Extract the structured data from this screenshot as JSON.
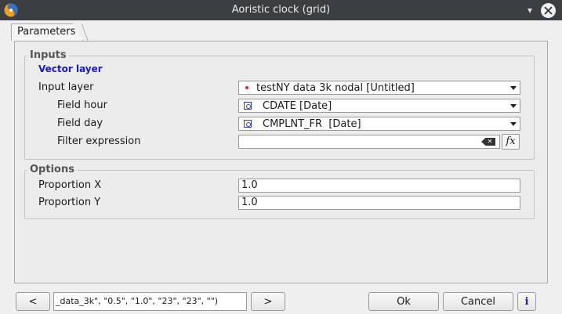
{
  "window": {
    "title": "Aoristic clock (grid)",
    "minimize_glyph": "▾",
    "close_glyph": "✕"
  },
  "tabs": [
    {
      "label": "Parameters"
    }
  ],
  "inputs": {
    "group_title": "Inputs",
    "sub_heading": "Vector layer",
    "input_layer": {
      "label": "Input layer",
      "value": "testNY data 3k nodal [Untitled]",
      "icon": "point-layer-icon"
    },
    "field_hour": {
      "label": "Field hour",
      "value": "CDATE [Date]",
      "icon": "field-icon"
    },
    "field_day": {
      "label": "Field day",
      "value": "CMPLNT_FR  [Date]",
      "icon": "field-icon"
    },
    "filter_expression": {
      "label": "Filter expression",
      "value": "",
      "fx_label": "fx",
      "clear_icon": "clear-icon"
    }
  },
  "options": {
    "group_title": "Options",
    "proportion_x": {
      "label": "Proportion X",
      "value": "1.0"
    },
    "proportion_y": {
      "label": "Proportion Y",
      "value": "1.0"
    }
  },
  "footer": {
    "prev_label": "<",
    "command": "_data_3k\", \"0.5\", \"1.0\", \"23\", \"23\", \"\")",
    "next_label": ">",
    "ok_label": "Ok",
    "cancel_label": "Cancel",
    "info_label": "i"
  },
  "colors": {
    "titlebar": "#3c3f41",
    "heading_blue": "#1a1ac8",
    "point_red": "#d23"
  }
}
